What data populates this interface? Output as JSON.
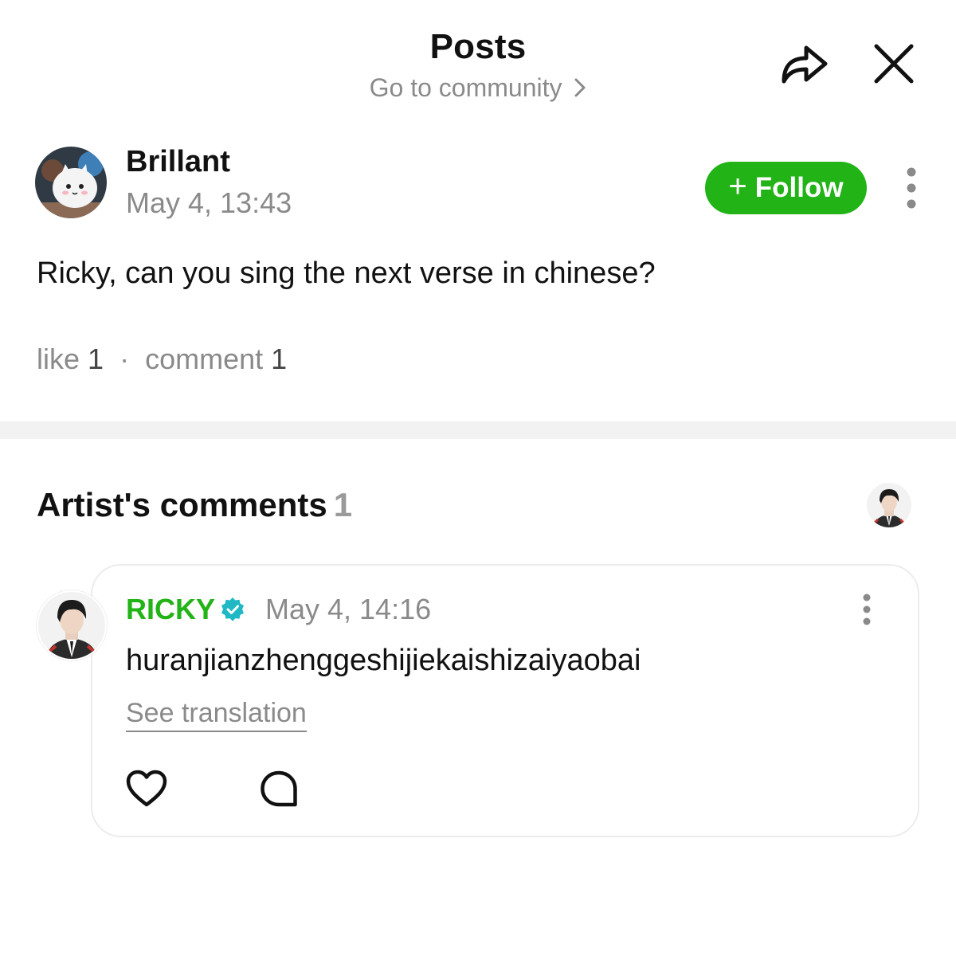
{
  "header": {
    "title": "Posts",
    "community_link": "Go to community",
    "icons": {
      "share": "share-icon",
      "close": "close-icon",
      "chevron": "chevron-right-icon"
    }
  },
  "post": {
    "author": "Brillant",
    "time": "May 4, 13:43",
    "follow_label": "Follow",
    "body": "Ricky, can you sing the next verse in chinese?",
    "stats": {
      "like_label": "like",
      "like_count": "1",
      "separator": "·",
      "comment_label": "comment",
      "comment_count": "1"
    }
  },
  "artist_comments": {
    "title": "Artist's comments",
    "count": "1",
    "comment": {
      "author": "RICKY",
      "time": "May 4, 14:16",
      "text": "huranjianzhenggeshijiekaishizaiyaobai",
      "translate_label": "See translation"
    }
  },
  "colors": {
    "accent_green": "#22b317",
    "verified_blue": "#1fb8c4",
    "muted_text": "#8a8a8a"
  }
}
